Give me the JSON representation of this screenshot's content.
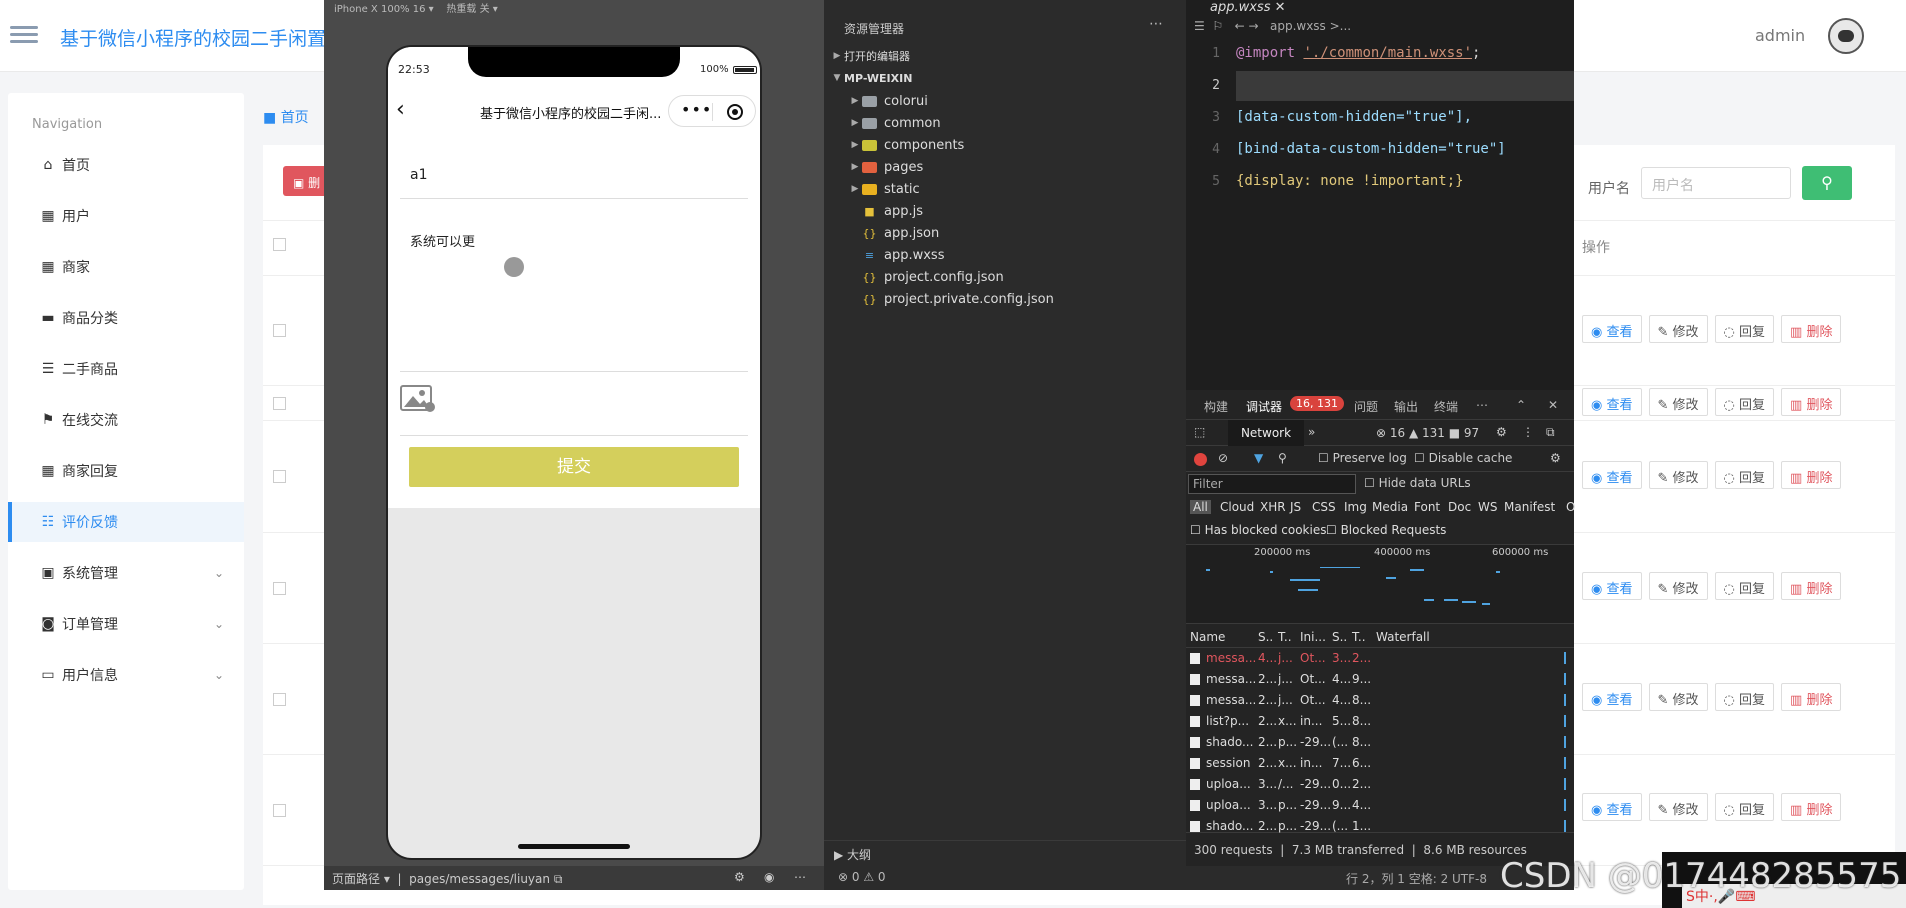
{
  "admin": {
    "site_title": "基于微信小程序的校园二手闲置物",
    "user": "admin",
    "nav_heading": "Navigation",
    "menu": [
      {
        "label": "首页",
        "icon": "home-icon"
      },
      {
        "label": "用户",
        "icon": "grid-icon"
      },
      {
        "label": "商家",
        "icon": "grid-icon"
      },
      {
        "label": "商品分类",
        "icon": "box-icon"
      },
      {
        "label": "二手商品",
        "icon": "list-icon"
      },
      {
        "label": "在线交流",
        "icon": "flag-icon"
      },
      {
        "label": "商家回复",
        "icon": "grid-icon"
      },
      {
        "label": "评价反馈",
        "icon": "sliders-icon",
        "active": true
      },
      {
        "label": "系统管理",
        "icon": "chat-icon",
        "expandable": true
      },
      {
        "label": "订单管理",
        "icon": "ticket-icon",
        "expandable": true
      },
      {
        "label": "用户信息",
        "icon": "card-icon",
        "expandable": true
      }
    ],
    "breadcrumb_home": "首页",
    "delete_label": "删",
    "search_label": "用户名",
    "search_placeholder": "用户名",
    "ops_header": "操作",
    "ops": {
      "view": "查看",
      "edit": "修改",
      "reply": "回复",
      "delete": "删除"
    }
  },
  "simulator": {
    "top_label": "iPhone X 100% 16",
    "hot_reload": "热重载 关",
    "time": "22:53",
    "battery": "100%",
    "page_title": "基于微信小程序的校园二手闲...",
    "input_value": "a1",
    "textarea_value": "系统可以更",
    "submit_label": "提交",
    "footer_path_label": "页面路径",
    "footer_path": "pages/messages/liuyan"
  },
  "explorer": {
    "title": "资源管理器",
    "open_editors": "打开的编辑器",
    "project": "MP-WEIXIN",
    "items": [
      {
        "name": "colorui",
        "type": "folder",
        "color": "#9aa0a6"
      },
      {
        "name": "common",
        "type": "folder",
        "color": "#9aa0a6"
      },
      {
        "name": "components",
        "type": "folder",
        "color": "#c9c338"
      },
      {
        "name": "pages",
        "type": "folder",
        "color": "#e2613f"
      },
      {
        "name": "static",
        "type": "folder",
        "color": "#e8b020"
      },
      {
        "name": "app.js",
        "type": "file",
        "icon": "JS",
        "color": "#e5c13b"
      },
      {
        "name": "app.json",
        "type": "file",
        "icon": "{..}",
        "color": "#e5c13b"
      },
      {
        "name": "app.wxss",
        "type": "file",
        "icon": "≡",
        "color": "#4fa3e0"
      },
      {
        "name": "project.config.json",
        "type": "file",
        "icon": "{..}",
        "color": "#e5c13b"
      },
      {
        "name": "project.private.config.json",
        "type": "file",
        "icon": "{..}",
        "color": "#e5c13b"
      }
    ],
    "outline": "大纲",
    "footer": "⊗ 0 ⚠ 0"
  },
  "editor": {
    "tab": "app.wxss",
    "breadcrumb": "app.wxss >...",
    "lines": [
      {
        "num": "1",
        "import_kw": "@import",
        "import_str": "'./common/main.wxss'",
        "end": ";"
      },
      {
        "num": "2"
      },
      {
        "num": "3",
        "text": "[data-custom-hidden=\"true\"],"
      },
      {
        "num": "4",
        "text": "[bind-data-custom-hidden=\"true\"]"
      },
      {
        "num": "5",
        "text": "{display: none !important;}"
      }
    ]
  },
  "devtools": {
    "tabs": [
      "构建",
      "调试器",
      "问题",
      "输出",
      "终端"
    ],
    "badge": "16, 131",
    "network_label": "Network",
    "counts": "⊗ 16 ▲ 131 ■ 97",
    "preserve_log": "Preserve log",
    "disable_cache": "Disable cache",
    "filter_placeholder": "Filter",
    "hide_data_urls": "Hide data URLs",
    "types": [
      "All",
      "Cloud",
      "XHR",
      "JS",
      "CSS",
      "Img",
      "Media",
      "Font",
      "Doc",
      "WS",
      "Manifest",
      "O"
    ],
    "has_blocked_cookies": "Has blocked cookies",
    "blocked_requests": "Blocked Requests",
    "timeline_ticks": [
      "200000 ms",
      "400000 ms",
      "600000 ms"
    ],
    "columns": [
      "Name",
      "S..",
      "T..",
      "Ini...",
      "S..",
      "T..",
      "Waterfall"
    ],
    "rows": [
      {
        "name": "messa...",
        "s": "4...",
        "t": "j...",
        "ini": "Ot...",
        "size": "3...",
        "time": "2...",
        "error": true
      },
      {
        "name": "messa...",
        "s": "2...",
        "t": "j...",
        "ini": "Ot...",
        "size": "4...",
        "time": "9..."
      },
      {
        "name": "messa...",
        "s": "2...",
        "t": "j...",
        "ini": "Ot...",
        "size": "4...",
        "time": "8..."
      },
      {
        "name": "list?p...",
        "s": "2...",
        "t": "x...",
        "ini": "in...",
        "size": "5...",
        "time": "8..."
      },
      {
        "name": "shado...",
        "s": "2...",
        "t": "p...",
        "ini": "-29...",
        "size": "(...",
        "time": "8..."
      },
      {
        "name": "session",
        "s": "2...",
        "t": "x...",
        "ini": "in...",
        "size": "7...",
        "time": "6..."
      },
      {
        "name": "uploa...",
        "s": "3...",
        "t": "/...",
        "ini": "-29...",
        "size": "0...",
        "time": "2..."
      },
      {
        "name": "uploa...",
        "s": "3...",
        "t": "p...",
        "ini": "-29...",
        "size": "9...",
        "time": "4..."
      },
      {
        "name": "shado...",
        "s": "2...",
        "t": "p...",
        "ini": "-29...",
        "size": "(...",
        "time": "1..."
      }
    ],
    "status": {
      "requests": "300 requests",
      "transferred": "7.3 MB transferred",
      "resources": "8.6 MB resources"
    }
  },
  "editor_status": "行 2，列 1   空格: 2   UTF-8",
  "watermark": "CSDN @017448285575",
  "tray": "S中·,🎤⌨"
}
